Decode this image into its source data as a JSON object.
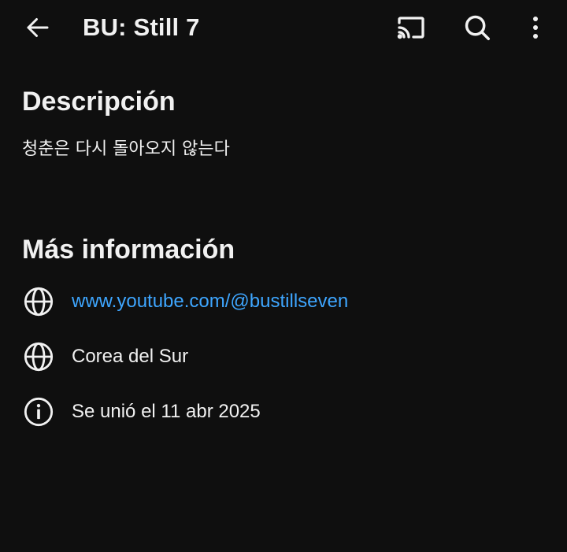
{
  "header": {
    "title": "BU: Still 7",
    "icons": {
      "back": "arrow-left-icon",
      "cast": "cast-icon",
      "search": "search-icon",
      "more": "more-vertical-icon"
    }
  },
  "description": {
    "heading": "Descripción",
    "text": "청춘은 다시 돌아오지 않는다"
  },
  "more_info": {
    "heading": "Más información",
    "rows": [
      {
        "icon": "globe-icon",
        "text": "www.youtube.com/@bustillseven",
        "is_link": true
      },
      {
        "icon": "globe-icon",
        "text": "Corea del Sur",
        "is_link": false
      },
      {
        "icon": "info-icon",
        "text": "Se unió el 11 abr 2025",
        "is_link": false
      }
    ]
  },
  "colors": {
    "background": "#0f0f0f",
    "text": "#f1f1f1",
    "link": "#3ea6ff"
  }
}
